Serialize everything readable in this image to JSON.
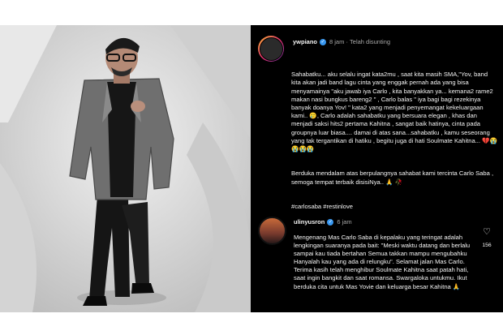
{
  "post": {
    "username": "ywpiano",
    "time": "8 jam",
    "edited": "Telah disunting",
    "caption_paragraphs": [
      "Sahabatku... aku selalu ingat kata2mu , saat kita masih SMA,\"Yov, band kita akan jadi band lagu cinta yang enggak pernah ada yang bisa menyamainya \"aku jawab iya Carlo , kita banyakkan ya... kemana2 rame2 makan nasi bungkus bareng2 \" , Carlo balas \" iya bagi bagi rezekinya banyak doanya Yov! \" kata2 yang menjadi penyemangat kekeluargaan kami.. 🥲, Carlo adalah sahabatku yang bersuara elegan , khas dan menjadi saksi hits2 pertama Kahitna , sangat baik hatinya, cinta pada groupnya luar biasa.... damai di atas sana...sahabatku , kamu seseorang yang tak tergantikan di hatiku , begitu juga di hati Soulmate Kahitna... 💔😭😭😭😭",
      "Berduka mendalam atas berpulangnya sahabat kami tercinta Carlo Saba , semoga tempat terbaik disisiNya.. 🙏 🥀",
      "#carlosaba #restinlove"
    ]
  },
  "comment": {
    "username": "ulinyusron",
    "time": "6 jam",
    "text": "Mengenang Mas Carlo Saba di kepalaku yang teringat adalah lengkingan suaranya pada bait: \"Meski waktu datang dan berlalu sampai kau tiada bertahan Semua takkan mampu mengubahku Hanyalah kau yang ada di relungku\". Selamat jalan Mas Carlo. Terima kasih telah menghibur Soulmate Kahitna saat patah hati, saat ingin bangkit dan saat romansa. Swargaloka untukmu. Ikut berduka cita untuk Mas Yovie dan keluarga besar Kahitna 🙏",
    "likes": "156"
  },
  "icons": {
    "verified": "verified-badge-icon",
    "like": "heart-icon"
  },
  "colors": {
    "panel_bg": "#000000",
    "verified": "#3897f0",
    "muted": "#a8a8a8"
  }
}
